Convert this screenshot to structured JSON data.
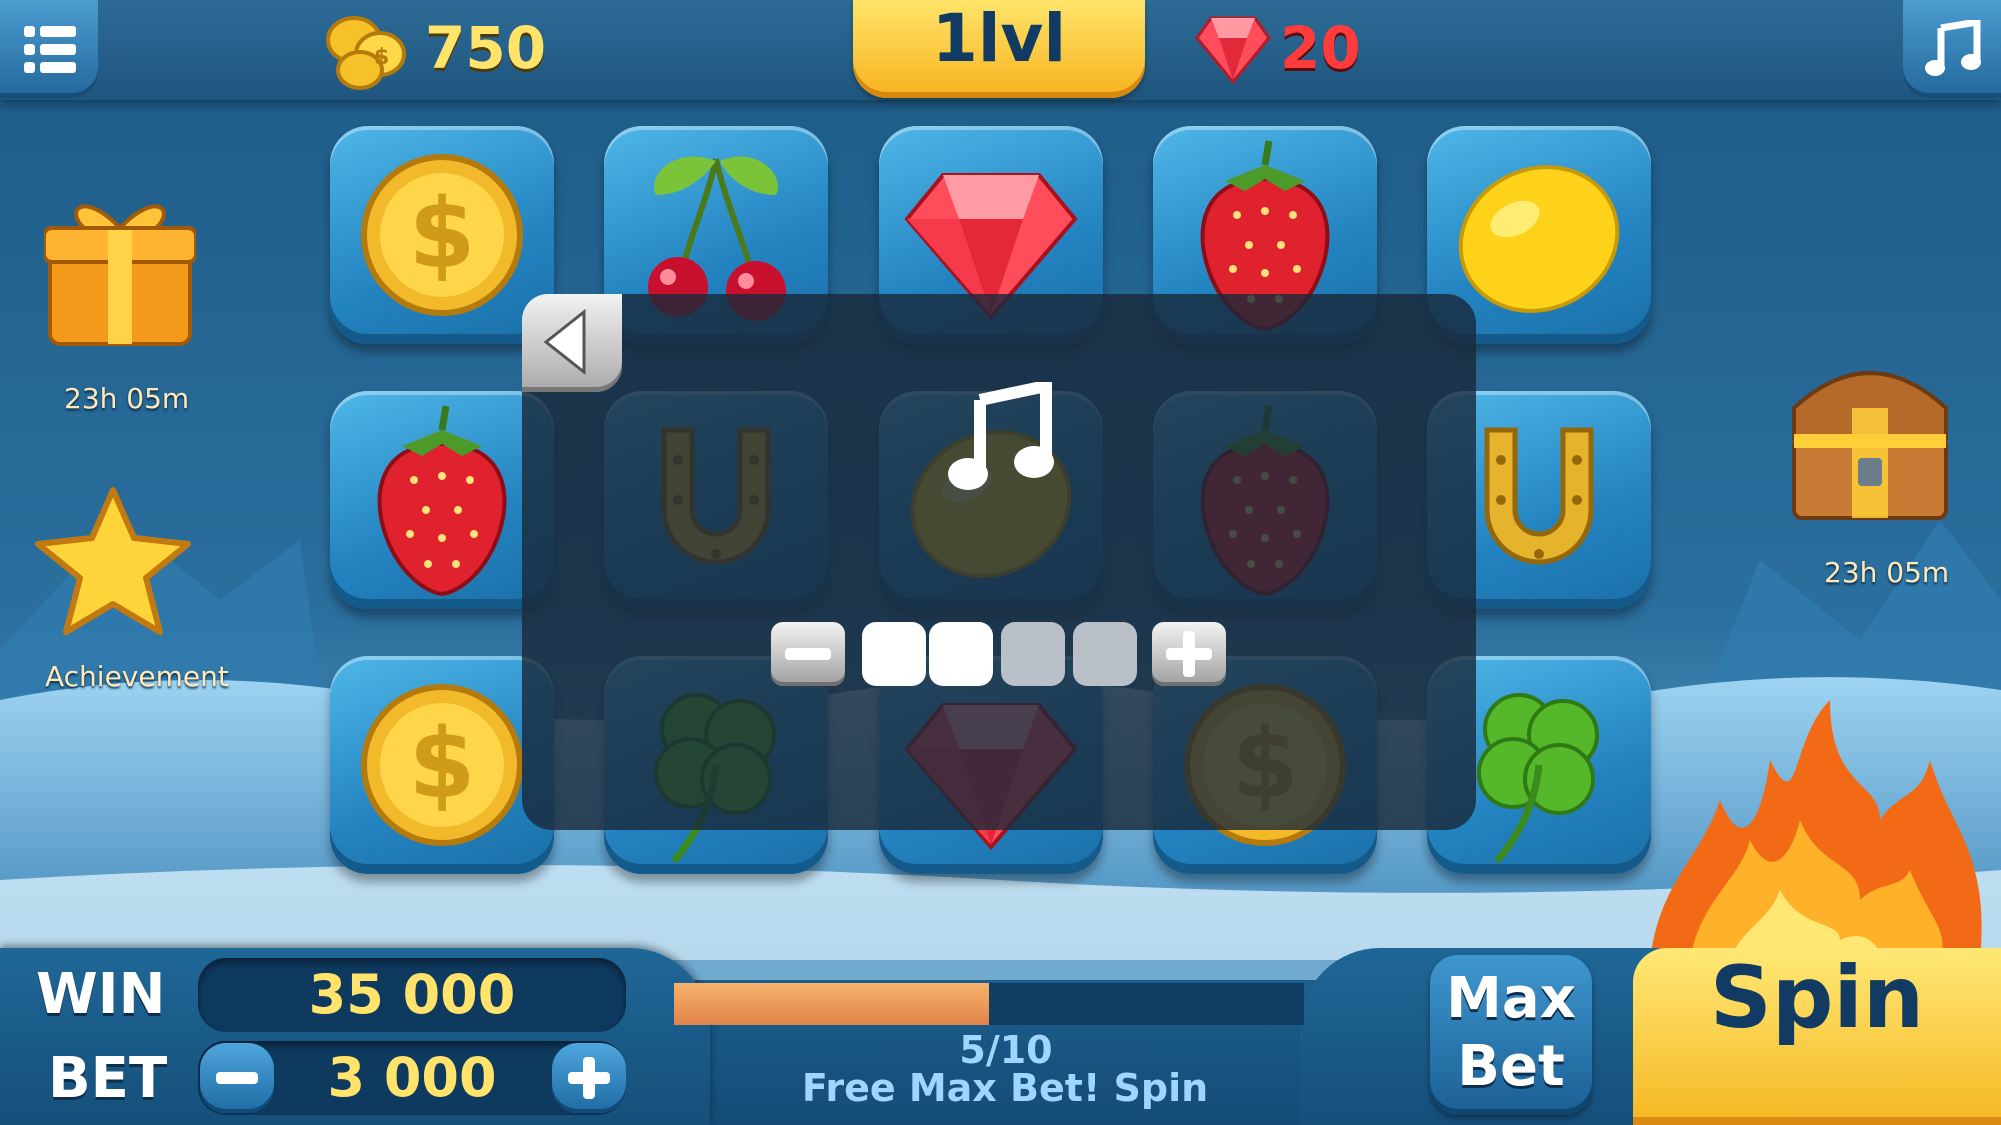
{
  "header": {
    "coins": "750",
    "level": "1lvl",
    "gems": "20"
  },
  "side": {
    "gift_timer": "23h 05m",
    "achievement_label": "Achievement",
    "chest_timer": "23h 05m"
  },
  "reels": [
    [
      "coin-icon",
      "cherry-icon",
      "diamond-icon",
      "strawberry-icon",
      "lemon-icon"
    ],
    [
      "strawberry-icon",
      "horseshoe-icon",
      "lemon-icon",
      "strawberry-icon",
      "horseshoe-icon"
    ],
    [
      "coin-icon",
      "clover-icon",
      "diamond-icon",
      "coin-icon",
      "clover-icon"
    ]
  ],
  "volume": {
    "level": 2,
    "max": 4
  },
  "bottom": {
    "win_label": "WIN",
    "win_value": "35 000",
    "bet_label": "BET",
    "bet_value": "3 000",
    "free_spins_progress": "5/10",
    "free_spins_fraction": 0.5,
    "free_spins_label": "Free Max Bet! Spin",
    "max_bet_line1": "Max",
    "max_bet_line2": "Bet",
    "spin_label": "Spin"
  },
  "colors": {
    "accent_gold": "#f7b21e",
    "gem_red": "#ff3b3b",
    "panel_blue": "#1f6797"
  }
}
